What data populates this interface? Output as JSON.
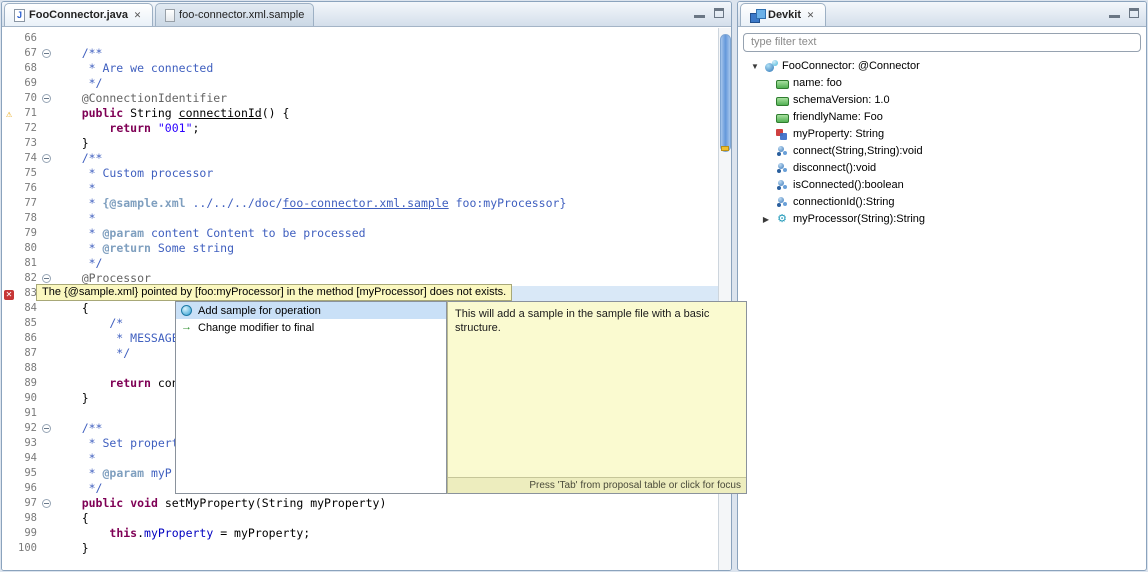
{
  "colors": {
    "selection_blue": "#c9e0f7",
    "tooltip_yellow": "#fbf8c0",
    "detail_yellow": "#fafad0",
    "keyword": "#7F0055",
    "string": "#2A00FF",
    "javadoc": "#3F5FBF",
    "annotation_gray": "#646464",
    "field_blue": "#0000C0"
  },
  "editor_tabs": [
    {
      "label": "FooConnector.java",
      "icon": "java-file",
      "active": true
    },
    {
      "label": "foo-connector.xml.sample",
      "icon": "file",
      "active": false
    }
  ],
  "code": {
    "lines": [
      {
        "n": 66,
        "seg": []
      },
      {
        "n": 67,
        "fold": true,
        "seg": [
          [
            "c",
            "    /**"
          ]
        ]
      },
      {
        "n": 68,
        "seg": [
          [
            "c",
            "     * Are we connected"
          ]
        ]
      },
      {
        "n": 69,
        "seg": [
          [
            "c",
            "     */"
          ]
        ]
      },
      {
        "n": 70,
        "fold": true,
        "seg": [
          [
            "a",
            "    @ConnectionIdentifier"
          ]
        ]
      },
      {
        "n": 71,
        "icon": "warning",
        "seg": [
          [
            "k",
            "    public"
          ],
          [
            "p",
            " String "
          ],
          [
            "u",
            "connectionId"
          ],
          [
            "p",
            "() {"
          ]
        ]
      },
      {
        "n": 72,
        "seg": [
          [
            "p",
            "        "
          ],
          [
            "k",
            "return"
          ],
          [
            "p",
            " "
          ],
          [
            "s",
            "\"001\""
          ],
          [
            "p",
            ";"
          ]
        ]
      },
      {
        "n": 73,
        "seg": [
          [
            "p",
            "    }"
          ]
        ]
      },
      {
        "n": 74,
        "fold": true,
        "seg": [
          [
            "c",
            "    /**"
          ]
        ]
      },
      {
        "n": 75,
        "seg": [
          [
            "c",
            "     * Custom processor"
          ]
        ]
      },
      {
        "n": 76,
        "seg": [
          [
            "c",
            "     *"
          ]
        ]
      },
      {
        "n": 77,
        "seg": [
          [
            "c",
            "     * "
          ],
          [
            "t",
            "{@sample.xml"
          ],
          [
            "c",
            " ../../../doc/"
          ],
          [
            "cu",
            "foo-connector.xml.sample"
          ],
          [
            "c",
            " foo:myProcessor}"
          ]
        ]
      },
      {
        "n": 78,
        "seg": [
          [
            "c",
            "     *"
          ]
        ]
      },
      {
        "n": 79,
        "seg": [
          [
            "c",
            "     * "
          ],
          [
            "t",
            "@param"
          ],
          [
            "c",
            " content Content to be processed"
          ]
        ]
      },
      {
        "n": 80,
        "seg": [
          [
            "c",
            "     * "
          ],
          [
            "t",
            "@return"
          ],
          [
            "c",
            " Some string"
          ]
        ]
      },
      {
        "n": 81,
        "seg": [
          [
            "c",
            "     */"
          ]
        ]
      },
      {
        "n": 82,
        "fold": true,
        "seg": [
          [
            "a",
            "    @Processor"
          ]
        ]
      },
      {
        "n": 83,
        "icon": "error",
        "current": true,
        "seg": []
      },
      {
        "n": 84,
        "seg": [
          [
            "p",
            "    {"
          ]
        ]
      },
      {
        "n": 85,
        "seg": [
          [
            "c",
            "        /*"
          ]
        ]
      },
      {
        "n": 86,
        "seg": [
          [
            "c",
            "         * MESSAGE"
          ]
        ]
      },
      {
        "n": 87,
        "seg": [
          [
            "c",
            "         */"
          ]
        ]
      },
      {
        "n": 88,
        "seg": []
      },
      {
        "n": 89,
        "seg": [
          [
            "p",
            "        "
          ],
          [
            "k",
            "return"
          ],
          [
            "p",
            " con"
          ]
        ]
      },
      {
        "n": 90,
        "seg": [
          [
            "p",
            "    }"
          ]
        ]
      },
      {
        "n": 91,
        "seg": []
      },
      {
        "n": 92,
        "fold": true,
        "seg": [
          [
            "c",
            "    /**"
          ]
        ]
      },
      {
        "n": 93,
        "seg": [
          [
            "c",
            "     * Set propert"
          ]
        ]
      },
      {
        "n": 94,
        "seg": [
          [
            "c",
            "     *"
          ]
        ]
      },
      {
        "n": 95,
        "seg": [
          [
            "c",
            "     * "
          ],
          [
            "t",
            "@param"
          ],
          [
            "c",
            " myP"
          ]
        ]
      },
      {
        "n": 96,
        "seg": [
          [
            "c",
            "     */"
          ]
        ]
      },
      {
        "n": 97,
        "fold": true,
        "seg": [
          [
            "k",
            "    public"
          ],
          [
            "p",
            " "
          ],
          [
            "k",
            "void"
          ],
          [
            "p",
            " setMyProperty(String myProperty)"
          ]
        ]
      },
      {
        "n": 98,
        "seg": [
          [
            "p",
            "    {"
          ]
        ]
      },
      {
        "n": 99,
        "seg": [
          [
            "p",
            "        "
          ],
          [
            "k",
            "this"
          ],
          [
            "p",
            "."
          ],
          [
            "f",
            "myProperty"
          ],
          [
            "p",
            " = myProperty;"
          ]
        ]
      },
      {
        "n": 100,
        "seg": [
          [
            "p",
            "    }"
          ]
        ]
      }
    ]
  },
  "annotation": {
    "text": "The {@sample.xml} pointed by [foo:myProcessor] in the method [myProcessor] does not exists."
  },
  "quickfix": {
    "items": [
      {
        "icon": "quickfix",
        "label": "Add sample for operation",
        "selected": true
      },
      {
        "icon": "change",
        "label": "Change modifier to final",
        "selected": false
      }
    ],
    "detail": "This will add a sample in the sample file with a basic structure.",
    "footer": "Press 'Tab' from proposal table or click for focus"
  },
  "devkit": {
    "title": "Devkit",
    "filter_placeholder": "type filter text",
    "tree": [
      {
        "label": "FooConnector: @Connector",
        "icon": "connector",
        "expand": "open",
        "level": 0
      },
      {
        "label": "name: foo",
        "icon": "attr",
        "level": 1
      },
      {
        "label": "schemaVersion: 1.0",
        "icon": "attr",
        "level": 1
      },
      {
        "label": "friendlyName: Foo",
        "icon": "attr",
        "level": 1
      },
      {
        "label": "myProperty: String",
        "icon": "property",
        "level": 1
      },
      {
        "label": "connect(String,String):void",
        "icon": "method",
        "level": 1
      },
      {
        "label": "disconnect():void",
        "icon": "method",
        "level": 1
      },
      {
        "label": "isConnected():boolean",
        "icon": "method",
        "level": 1
      },
      {
        "label": "connectionId():String",
        "icon": "method",
        "level": 1
      },
      {
        "label": "myProcessor(String):String",
        "icon": "processor",
        "expand": "closed",
        "level": 1
      }
    ]
  }
}
